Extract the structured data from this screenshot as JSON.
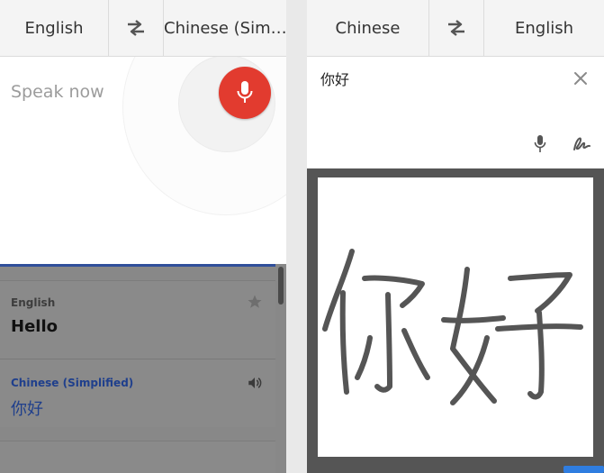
{
  "left_panel": {
    "source_language": "English",
    "target_language": "Chinese (Sim…",
    "speak_prompt": "Speak now",
    "result": {
      "source_label": "English",
      "source_text": "Hello",
      "target_label": "Chinese (Simplified)",
      "target_text": "你好"
    }
  },
  "right_panel": {
    "source_language": "Chinese",
    "target_language": "English",
    "input_text": "你好"
  },
  "icons": {
    "swap": "swap-arrows-icon",
    "mic": "microphone-icon",
    "close": "close-icon",
    "handwriting": "handwriting-icon",
    "star": "star-icon",
    "speaker": "speaker-icon"
  },
  "colors": {
    "mic_button": "#e23b2f",
    "accent_blue": "#2f4f9a",
    "handwriting_stroke": "#555555"
  }
}
